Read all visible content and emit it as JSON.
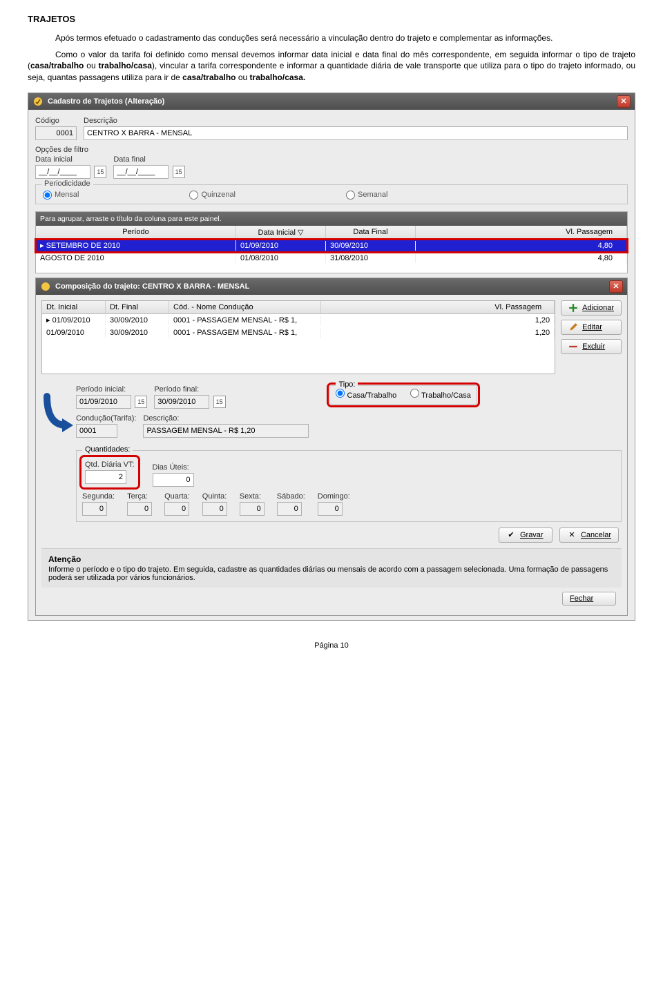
{
  "doc": {
    "heading": "TRAJETOS",
    "para1_pre": "Após termos efetuado o cadastramento das conduções será necessário a vinculação dentro do trajeto e complementar as informações.",
    "para2_a": "Como o valor da tarifa foi definido como mensal devemos informar data inicial e data final do mês correspondente, em seguida informar o tipo de trajeto (",
    "para2_b1": "casa/trabalho",
    "para2_b2": " ou ",
    "para2_b3": "trabalho/casa",
    "para2_c": "), vincular a tarifa correspondente e informar a quantidade diária de vale transporte que utiliza para o tipo do trajeto informado, ou seja, quantas passagens utiliza para ir de ",
    "para2_d1": "casa/trabalho",
    "para2_d2": " ou ",
    "para2_d3": "trabalho/casa.",
    "page": "Página 10"
  },
  "win1": {
    "title": "Cadastro de Trajetos (Alteração)",
    "codigo_lbl": "Código",
    "codigo": "0001",
    "descricao_lbl": "Descrição",
    "descricao": "CENTRO X BARRA - MENSAL",
    "filtro_lbl": "Opções de filtro",
    "di_lbl": "Data inicial",
    "df_lbl": "Data final",
    "di": "__/__/____",
    "df": "__/__/____",
    "period_lbl": "Periodicidade",
    "period_opts": {
      "mensal": "Mensal",
      "quinzenal": "Quinzenal",
      "semanal": "Semanal"
    },
    "group_hint": "Para agrupar, arraste o título da coluna para este painel.",
    "cols": {
      "periodo": "Período",
      "di": "Data Inicial",
      "df": "Data Final",
      "vl": "Vl. Passagem"
    },
    "rows": [
      {
        "periodo": "SETEMBRO DE 2010",
        "di": "01/09/2010",
        "df": "30/09/2010",
        "vl": "4,80"
      },
      {
        "periodo": "AGOSTO DE 2010",
        "di": "01/08/2010",
        "df": "31/08/2010",
        "vl": "4,80"
      }
    ]
  },
  "win2": {
    "title": "Composição do trajeto: CENTRO X BARRA - MENSAL",
    "cols": {
      "di": "Dt. Inicial",
      "df": "Dt. Final",
      "cod": "Cód. - Nome Condução",
      "vl": "Vl. Passagem"
    },
    "rows": [
      {
        "di": "01/09/2010",
        "df": "30/09/2010",
        "cod": "0001 - PASSAGEM MENSAL - R$ 1,",
        "vl": "1,20"
      },
      {
        "di": "01/09/2010",
        "df": "30/09/2010",
        "cod": "0001 - PASSAGEM MENSAL - R$ 1,",
        "vl": "1,20"
      }
    ],
    "btns": {
      "add": "Adicionar",
      "edit": "Editar",
      "del": "Excluir"
    },
    "form": {
      "pi_lbl": "Período inicial:",
      "pi": "01/09/2010",
      "pf_lbl": "Período final:",
      "pf": "30/09/2010",
      "tipo_lbl": "Tipo:",
      "tipo_ct": "Casa/Trabalho",
      "tipo_tc": "Trabalho/Casa",
      "cond_lbl": "Condução(Tarifa):",
      "cond": "0001",
      "desc_lbl": "Descrição:",
      "desc": "PASSAGEM MENSAL - R$ 1,20",
      "qtd_lbl": "Quantidades:",
      "qtdvt_lbl": "Qtd. Diária VT:",
      "qtdvt": "2",
      "dias_lbl": "Dias Úteis:",
      "dias": "0",
      "days": {
        "seg": "Segunda:",
        "ter": "Terça:",
        "qua": "Quarta:",
        "qui": "Quinta:",
        "sex": "Sexta:",
        "sab": "Sábado:",
        "dom": "Domingo:"
      },
      "dayval": "0",
      "gravar": "Gravar",
      "cancelar": "Cancelar"
    },
    "atencao_title": "Atenção",
    "atencao_text": "Informe o período e o tipo do trajeto. Em seguida, cadastre as quantidades diárias ou mensais de acordo com a passagem selecionada. Uma formação de passagens poderá ser utilizada por vários funcionários.",
    "fechar": "Fechar"
  }
}
